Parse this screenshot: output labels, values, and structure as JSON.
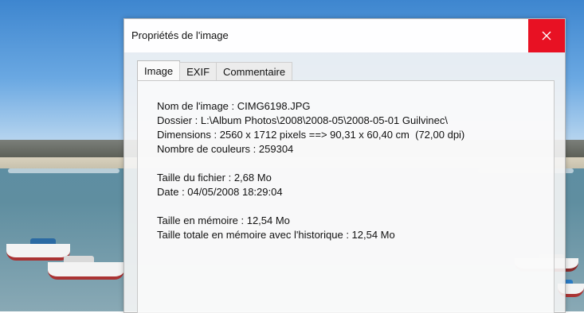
{
  "dialog": {
    "title": "Propriétés de l'image",
    "close_icon": "close-icon"
  },
  "tabs": [
    {
      "label": "Image",
      "active": true
    },
    {
      "label": "EXIF",
      "active": false
    },
    {
      "label": "Commentaire",
      "active": false
    }
  ],
  "image_info": {
    "name": "Nom de l'image : CIMG6198.JPG",
    "folder": "Dossier : L:\\Album Photos\\2008\\2008-05\\2008-05-01 Guilvinec\\",
    "dimensions": "Dimensions : 2560 x 1712 pixels ==> 90,31 x 60,40 cm  (72,00 dpi)",
    "colors": "Nombre de couleurs : 259304",
    "file_size": "Taille du fichier : 2,68 Mo",
    "date": "Date : 04/05/2008 18:29:04",
    "memory_size": "Taille en mémoire : 12,54 Mo",
    "memory_total": "Taille totale en mémoire avec l'historique : 12,54 Mo"
  },
  "colors": {
    "close_button_bg": "#e81123"
  }
}
